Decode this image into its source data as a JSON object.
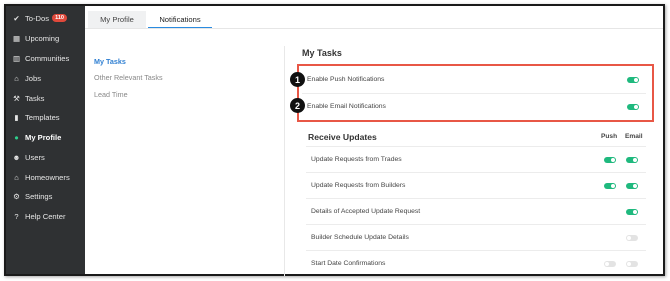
{
  "sidebar": {
    "items": [
      {
        "label": "To-Dos",
        "icon": "check-circle-icon",
        "badge": "110"
      },
      {
        "label": "Upcoming",
        "icon": "calendar-icon"
      },
      {
        "label": "Communities",
        "icon": "building-icon"
      },
      {
        "label": "Jobs",
        "icon": "home-icon"
      },
      {
        "label": "Tasks",
        "icon": "wrench-icon"
      },
      {
        "label": "Templates",
        "icon": "columns-icon"
      },
      {
        "label": "My Profile",
        "icon": "user-circle-icon",
        "active": true
      },
      {
        "label": "Users",
        "icon": "users-icon"
      },
      {
        "label": "Homeowners",
        "icon": "house-icon"
      },
      {
        "label": "Settings",
        "icon": "gear-icon"
      },
      {
        "label": "Help Center",
        "icon": "question-icon"
      }
    ]
  },
  "tabs": {
    "my_profile": "My Profile",
    "notifications": "Notifications"
  },
  "subnav": {
    "my_tasks": "My Tasks",
    "other_relevant_tasks": "Other Relevant Tasks",
    "lead_time": "Lead Time"
  },
  "my_tasks": {
    "title": "My Tasks",
    "rows": [
      {
        "label": "Enable Push Notifications",
        "on": true
      },
      {
        "label": "Enable Email Notifications",
        "on": true
      }
    ]
  },
  "callouts": [
    "1",
    "2"
  ],
  "receive_updates": {
    "title": "Receive Updates",
    "col_push": "Push",
    "col_email": "Email",
    "rows": [
      {
        "label": "Update Requests from Trades",
        "push": true,
        "email": true
      },
      {
        "label": "Update Requests from Builders",
        "push": true,
        "email": true
      },
      {
        "label": "Details of Accepted Update Request",
        "push": null,
        "email": true
      },
      {
        "label": "Builder Schedule Update Details",
        "push": null,
        "email": false
      },
      {
        "label": "Start Date Confirmations",
        "push": false,
        "email": false
      }
    ]
  },
  "colors": {
    "accent": "#2f7fd2",
    "toggle_on": "#1fb97e",
    "highlight": "#e85746",
    "sidebar_bg": "#2f3133"
  }
}
